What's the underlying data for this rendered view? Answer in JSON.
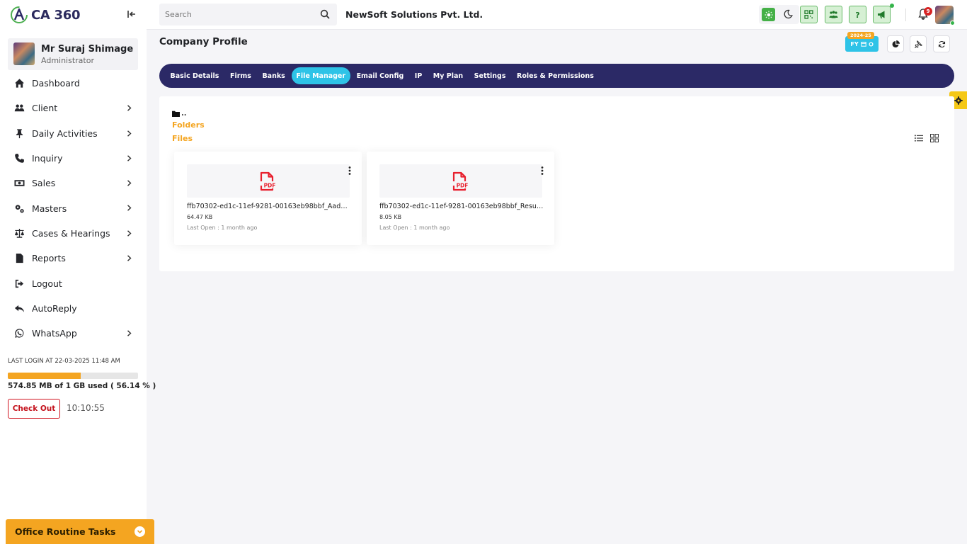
{
  "app": {
    "logo_text": "CA 360",
    "brand_color": "#2b2966",
    "accent_color": "#2ec3e7",
    "highlight_color": "#f4a521"
  },
  "user": {
    "name": "Mr Suraj Shimage",
    "role": "Administrator"
  },
  "sidebar": {
    "items": [
      {
        "label": "Dashboard",
        "icon": "home-icon",
        "has_submenu": false
      },
      {
        "label": "Client",
        "icon": "users-icon",
        "has_submenu": true
      },
      {
        "label": "Daily Activities",
        "icon": "pin-icon",
        "has_submenu": true
      },
      {
        "label": "Inquiry",
        "icon": "phone-icon",
        "has_submenu": true
      },
      {
        "label": "Sales",
        "icon": "money-icon",
        "has_submenu": true
      },
      {
        "label": "Masters",
        "icon": "gears-icon",
        "has_submenu": true
      },
      {
        "label": "Cases & Hearings",
        "icon": "scale-icon",
        "has_submenu": true
      },
      {
        "label": "Reports",
        "icon": "file-icon",
        "has_submenu": true
      },
      {
        "label": "Logout",
        "icon": "logout-icon",
        "has_submenu": false
      },
      {
        "label": "AutoReply",
        "icon": "reply-icon",
        "has_submenu": false
      },
      {
        "label": "WhatsApp",
        "icon": "whatsapp-icon",
        "has_submenu": true
      }
    ],
    "last_login": "LAST LOGIN AT 22-03-2025 11:48 AM",
    "storage_used_fraction": 0.5614,
    "storage_text": "574.85 MB of 1 GB used ( 56.14 % )",
    "checkout_label": "Check Out",
    "clock": "10:10:55",
    "tasks_label": "Office Routine Tasks"
  },
  "topbar": {
    "search_placeholder": "Search",
    "company_name": "NewSoft Solutions Pvt. Ltd.",
    "notification_count": "9"
  },
  "page": {
    "title": "Company Profile",
    "fy_label": "FY",
    "fy_year": "2024-25",
    "tabs": [
      {
        "label": "Basic Details",
        "active": false
      },
      {
        "label": "Firms",
        "active": false
      },
      {
        "label": "Banks",
        "active": false
      },
      {
        "label": "File Manager",
        "active": true
      },
      {
        "label": "Email Config",
        "active": false
      },
      {
        "label": "IP",
        "active": false
      },
      {
        "label": "My Plan",
        "active": false
      },
      {
        "label": "Settings",
        "active": false
      },
      {
        "label": "Roles & Permissions",
        "active": false
      }
    ]
  },
  "file_manager": {
    "parent_dir": "..",
    "folders_label": "Folders",
    "files_label": "Files",
    "files": [
      {
        "name": "ffb70302-ed1c-11ef-9281-00163eb98bbf_Aadhar...",
        "size": "64.47 KB",
        "last_open": "Last Open : 1 month ago",
        "type_label": "PDF"
      },
      {
        "name": "ffb70302-ed1c-11ef-9281-00163eb98bbf_Resum...",
        "size": "8.05 KB",
        "last_open": "Last Open : 1 month ago",
        "type_label": "PDF"
      }
    ]
  }
}
